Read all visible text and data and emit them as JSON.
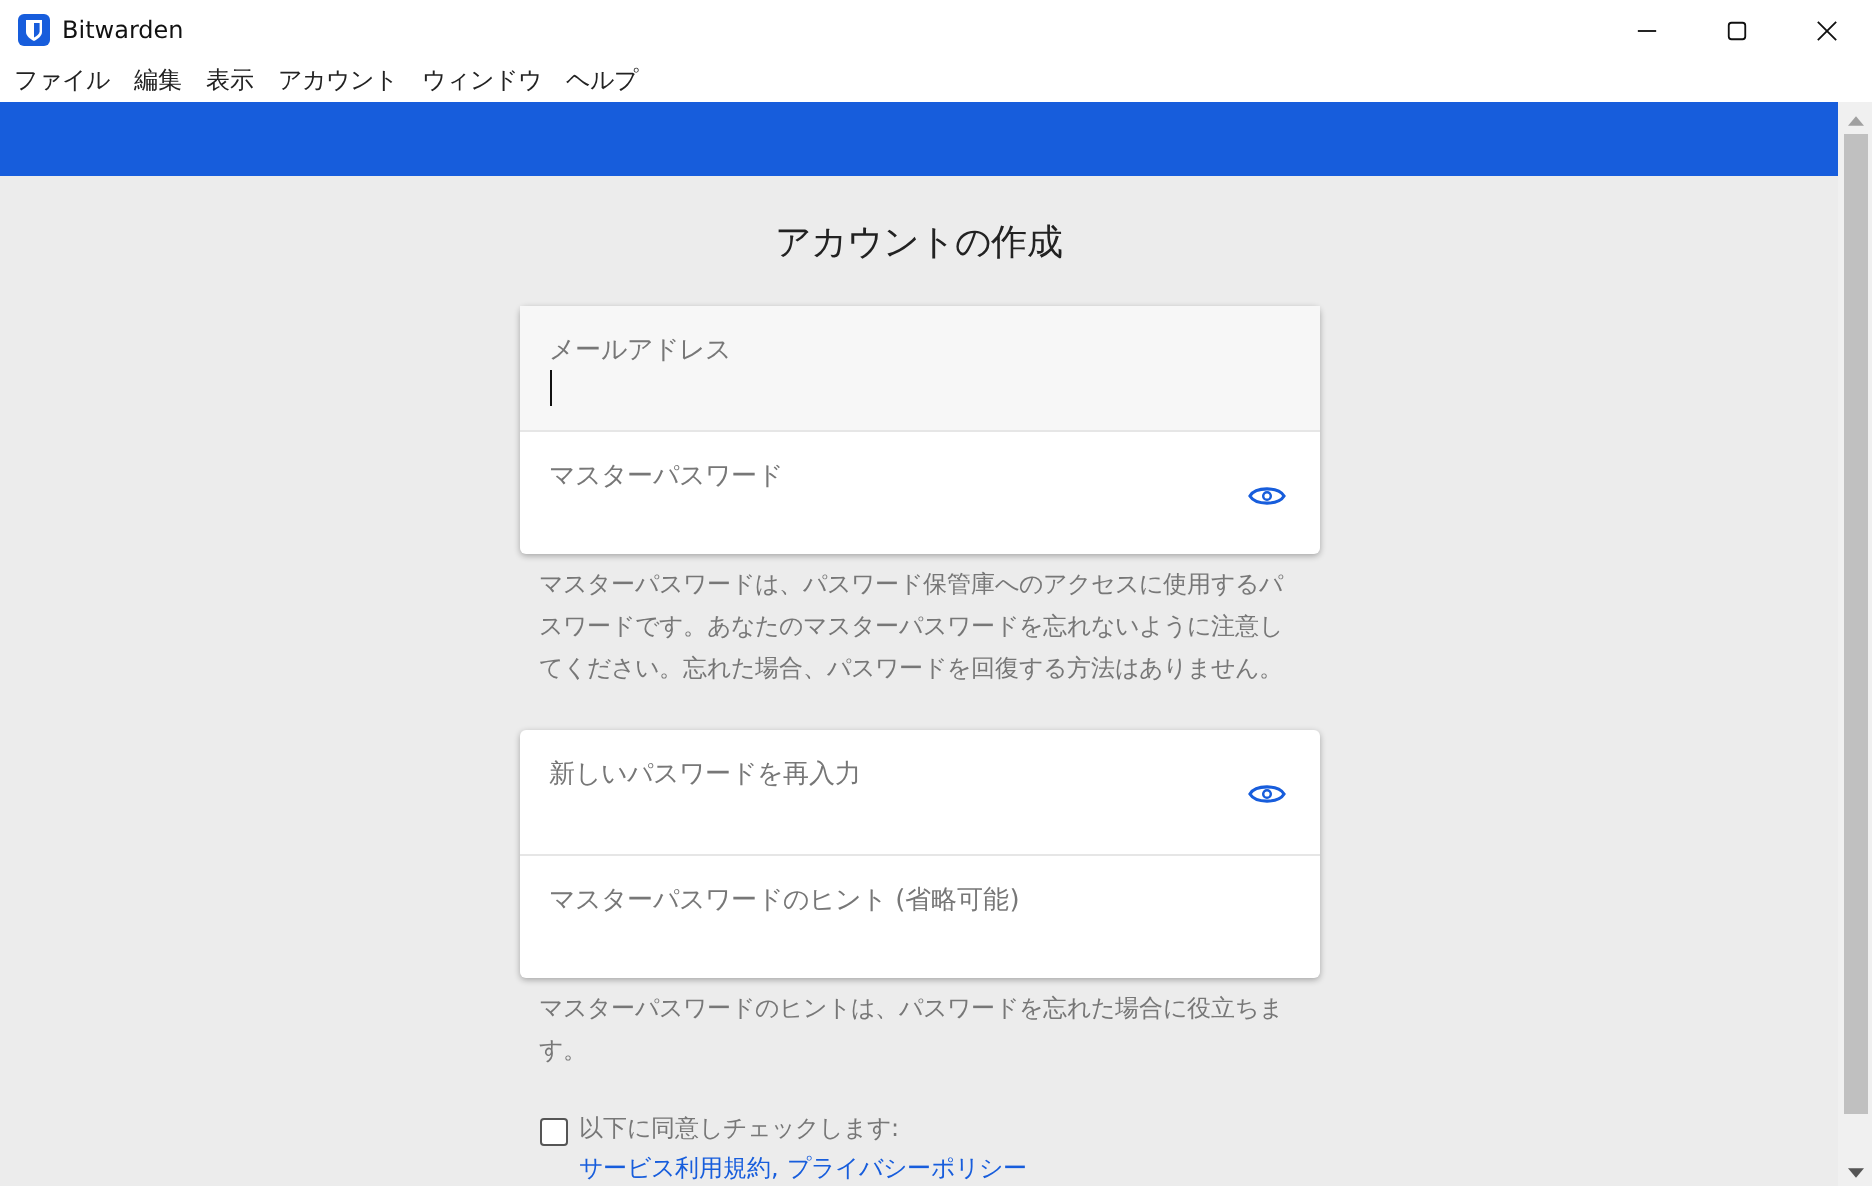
{
  "window": {
    "title": "Bitwarden"
  },
  "menu": [
    "ファイル",
    "編集",
    "表示",
    "アカウント",
    "ウィンドウ",
    "ヘルプ"
  ],
  "page_title": "アカウントの作成",
  "groups": [
    {
      "fields": [
        {
          "label": "メールアドレス",
          "kind": "text",
          "focused": true
        },
        {
          "label": "マスターパスワード",
          "kind": "password",
          "focused": false
        }
      ],
      "help": "マスターパスワードは、パスワード保管庫へのアクセスに使用するパスワードです。あなたのマスターパスワードを忘れないように注意してください。忘れた場合、パスワードを回復する方法はありません。"
    },
    {
      "fields": [
        {
          "label": "新しいパスワードを再入力",
          "kind": "password",
          "focused": false
        },
        {
          "label": "マスターパスワードのヒント (省略可能)",
          "kind": "text",
          "focused": false
        }
      ],
      "help": "マスターパスワードのヒントは、パスワードを忘れた場合に役立ちます。"
    }
  ],
  "agreement": {
    "checked": false,
    "label": "以下に同意しチェックします:",
    "links": [
      "サービス利用規約",
      "プライバシーポリシー"
    ],
    "link_separator": ","
  }
}
